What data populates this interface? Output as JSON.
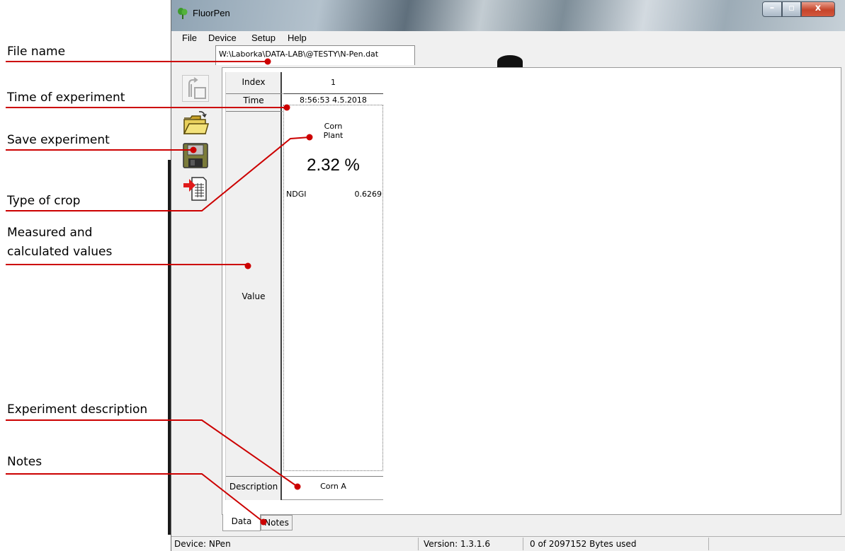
{
  "window": {
    "title": "FluorPen",
    "controls": {
      "minimize": "–",
      "maximize": "▫",
      "close": "x"
    }
  },
  "menu": [
    "File",
    "Device",
    "Setup",
    "Help"
  ],
  "document_tab": "W:\\Laborka\\DATA-LAB\\@TESTY\\N-Pen.dat",
  "toolbar": {
    "buttons": [
      "device-download-icon",
      "open-folder-icon",
      "save-disk-icon",
      "export-document-icon"
    ]
  },
  "table": {
    "headers": {
      "index": "Index",
      "time": "Time",
      "value": "Value",
      "description": "Description"
    },
    "record": {
      "index": "1",
      "time": "8:56:53  4.5.2018",
      "crop_line1": "Corn",
      "crop_line2": "Plant",
      "percent": "2.32 %",
      "ndgi_label": "NDGI",
      "ndgi_value": "0.6269",
      "description": "Corn A"
    }
  },
  "bottom_tabs": [
    "Data",
    "Notes"
  ],
  "status": {
    "device": "Device: NPen",
    "version": "Version: 1.3.1.6",
    "memory": "0 of 2097152 Bytes used"
  },
  "annotations": {
    "file_name": "File name",
    "time_of_experiment": "Time of experiment",
    "save_experiment": "Save experiment",
    "type_of_crop": "Type of crop",
    "measured_line1": "Measured and",
    "measured_line2": "calculated values",
    "experiment_description": "Experiment description",
    "notes": "Notes"
  },
  "colors": {
    "annotation_line": "#cc0000",
    "window_bg": "#f0f0f0"
  }
}
